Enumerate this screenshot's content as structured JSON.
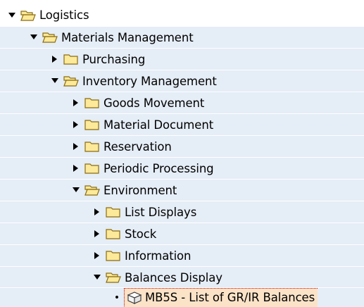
{
  "tree": {
    "items": [
      {
        "label": "Logistics",
        "state": "expanded",
        "icon": "folder-open-icon"
      },
      {
        "label": "Materials Management",
        "state": "expanded",
        "icon": "folder-open-icon"
      },
      {
        "label": "Purchasing",
        "state": "collapsed",
        "icon": "folder-closed-icon"
      },
      {
        "label": "Inventory Management",
        "state": "expanded",
        "icon": "folder-open-icon"
      },
      {
        "label": "Goods Movement",
        "state": "collapsed",
        "icon": "folder-closed-icon"
      },
      {
        "label": "Material Document",
        "state": "collapsed",
        "icon": "folder-closed-icon"
      },
      {
        "label": "Reservation",
        "state": "collapsed",
        "icon": "folder-closed-icon"
      },
      {
        "label": "Periodic Processing",
        "state": "collapsed",
        "icon": "folder-closed-icon"
      },
      {
        "label": "Environment",
        "state": "expanded",
        "icon": "folder-open-icon"
      },
      {
        "label": "List Displays",
        "state": "collapsed",
        "icon": "folder-closed-icon"
      },
      {
        "label": "Stock",
        "state": "collapsed",
        "icon": "folder-closed-icon"
      },
      {
        "label": "Information",
        "state": "collapsed",
        "icon": "folder-closed-icon"
      },
      {
        "label": "Balances Display",
        "state": "expanded",
        "icon": "folder-open-icon"
      },
      {
        "label": "MB5S - List of GR/IR Balances",
        "state": "leaf",
        "icon": "transaction-cube-icon",
        "selected": true
      }
    ]
  },
  "colors": {
    "shaded_row": "#e5edf6",
    "folder_fill": "#fde99a",
    "folder_stroke": "#8a6d10",
    "selected_bg": "#fbe3c8",
    "selected_border": "#cc0000"
  }
}
